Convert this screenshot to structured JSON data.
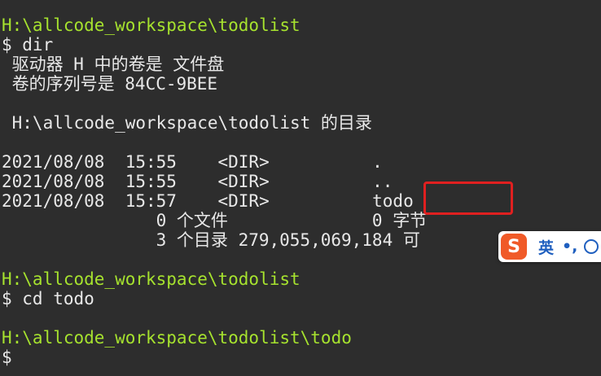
{
  "terminal": {
    "lines": [
      {
        "text": "H:\\allcode_workspace\\todolist",
        "type": "path"
      },
      {
        "text": "$ dir",
        "type": "cmd"
      },
      {
        "text": " 驱动器 H 中的卷是 文件盘",
        "type": "out"
      },
      {
        "text": " 卷的序列号是 84CC-9BEE",
        "type": "out"
      },
      {
        "text": "",
        "type": "out"
      },
      {
        "text": " H:\\allcode_workspace\\todolist 的目录",
        "type": "out"
      },
      {
        "text": "",
        "type": "out"
      },
      {
        "text": "2021/08/08  15:55    <DIR>          .",
        "type": "out"
      },
      {
        "text": "2021/08/08  15:55    <DIR>          ..",
        "type": "out"
      },
      {
        "text": "2021/08/08  15:57    <DIR>          todo",
        "type": "out"
      },
      {
        "text": "               0 个文件              0 字节",
        "type": "out"
      },
      {
        "text": "               3 个目录 279,055,069,184 可",
        "type": "out"
      },
      {
        "text": "",
        "type": "out"
      },
      {
        "text": "H:\\allcode_workspace\\todolist",
        "type": "path"
      },
      {
        "text": "$ cd todo",
        "type": "cmd"
      },
      {
        "text": "",
        "type": "out"
      },
      {
        "text": "H:\\allcode_workspace\\todolist\\todo",
        "type": "path"
      },
      {
        "text": "$",
        "type": "cmd"
      }
    ]
  },
  "ime": {
    "logo": "S",
    "lang": "英",
    "punct": "•,",
    "emoji_icon": "smiley-icon"
  },
  "colors": {
    "background": "#2d2d2d",
    "path": "#a6e22e",
    "text": "#e8e8e8",
    "highlight": "#e02020"
  }
}
